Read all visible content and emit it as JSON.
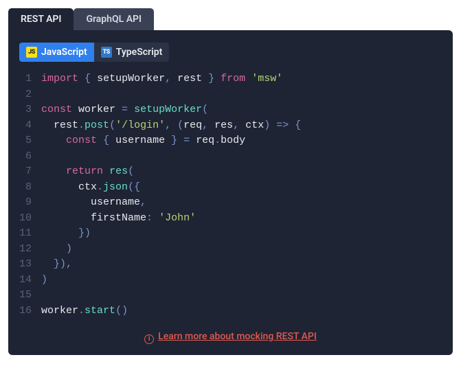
{
  "apiTabs": {
    "rest": "REST API",
    "graphql": "GraphQL API"
  },
  "langTabs": {
    "js": {
      "badge": "JS",
      "label": "JavaScript"
    },
    "ts": {
      "badge": "TS",
      "label": "TypeScript"
    }
  },
  "code": {
    "totalLines": 16,
    "lines": {
      "l1": [
        {
          "c": "tk-kw",
          "t": "import"
        },
        {
          "c": "tk-id",
          "t": " "
        },
        {
          "c": "tk-pn",
          "t": "{"
        },
        {
          "c": "tk-id",
          "t": " setupWorker"
        },
        {
          "c": "tk-pn",
          "t": ","
        },
        {
          "c": "tk-id",
          "t": " rest "
        },
        {
          "c": "tk-pn",
          "t": "}"
        },
        {
          "c": "tk-id",
          "t": " "
        },
        {
          "c": "tk-kw",
          "t": "from"
        },
        {
          "c": "tk-id",
          "t": " "
        },
        {
          "c": "tk-str",
          "t": "'msw'"
        }
      ],
      "l2": [],
      "l3": [
        {
          "c": "tk-kw",
          "t": "const"
        },
        {
          "c": "tk-id",
          "t": " worker "
        },
        {
          "c": "tk-op",
          "t": "="
        },
        {
          "c": "tk-id",
          "t": " "
        },
        {
          "c": "tk-fn",
          "t": "setupWorker"
        },
        {
          "c": "tk-pn",
          "t": "("
        }
      ],
      "l4": [
        {
          "c": "tk-id",
          "t": "  rest"
        },
        {
          "c": "tk-pn",
          "t": "."
        },
        {
          "c": "tk-fn",
          "t": "post"
        },
        {
          "c": "tk-pn",
          "t": "("
        },
        {
          "c": "tk-str",
          "t": "'/login'"
        },
        {
          "c": "tk-pn",
          "t": ","
        },
        {
          "c": "tk-id",
          "t": " "
        },
        {
          "c": "tk-pn",
          "t": "("
        },
        {
          "c": "tk-id",
          "t": "req"
        },
        {
          "c": "tk-pn",
          "t": ","
        },
        {
          "c": "tk-id",
          "t": " res"
        },
        {
          "c": "tk-pn",
          "t": ","
        },
        {
          "c": "tk-id",
          "t": " ctx"
        },
        {
          "c": "tk-pn",
          "t": ")"
        },
        {
          "c": "tk-id",
          "t": " "
        },
        {
          "c": "tk-op",
          "t": "=>"
        },
        {
          "c": "tk-id",
          "t": " "
        },
        {
          "c": "tk-pn",
          "t": "{"
        }
      ],
      "l5": [
        {
          "c": "tk-id",
          "t": "    "
        },
        {
          "c": "tk-kw",
          "t": "const"
        },
        {
          "c": "tk-id",
          "t": " "
        },
        {
          "c": "tk-pn",
          "t": "{"
        },
        {
          "c": "tk-id",
          "t": " username "
        },
        {
          "c": "tk-pn",
          "t": "}"
        },
        {
          "c": "tk-id",
          "t": " "
        },
        {
          "c": "tk-op",
          "t": "="
        },
        {
          "c": "tk-id",
          "t": " req"
        },
        {
          "c": "tk-pn",
          "t": "."
        },
        {
          "c": "tk-id",
          "t": "body"
        }
      ],
      "l6": [],
      "l7": [
        {
          "c": "tk-id",
          "t": "    "
        },
        {
          "c": "tk-kw",
          "t": "return"
        },
        {
          "c": "tk-id",
          "t": " "
        },
        {
          "c": "tk-fn",
          "t": "res"
        },
        {
          "c": "tk-pn",
          "t": "("
        }
      ],
      "l8": [
        {
          "c": "tk-id",
          "t": "      ctx"
        },
        {
          "c": "tk-pn",
          "t": "."
        },
        {
          "c": "tk-fn",
          "t": "json"
        },
        {
          "c": "tk-pn",
          "t": "({"
        }
      ],
      "l9": [
        {
          "c": "tk-id",
          "t": "        username"
        },
        {
          "c": "tk-pn",
          "t": ","
        }
      ],
      "l10": [
        {
          "c": "tk-id",
          "t": "        firstName"
        },
        {
          "c": "tk-pn",
          "t": ":"
        },
        {
          "c": "tk-id",
          "t": " "
        },
        {
          "c": "tk-str",
          "t": "'John'"
        }
      ],
      "l11": [
        {
          "c": "tk-id",
          "t": "      "
        },
        {
          "c": "tk-pn",
          "t": "})"
        }
      ],
      "l12": [
        {
          "c": "tk-id",
          "t": "    "
        },
        {
          "c": "tk-pn",
          "t": ")"
        }
      ],
      "l13": [
        {
          "c": "tk-id",
          "t": "  "
        },
        {
          "c": "tk-pn",
          "t": "}),"
        }
      ],
      "l14": [
        {
          "c": "tk-pn",
          "t": ")"
        }
      ],
      "l15": [],
      "l16": [
        {
          "c": "tk-id",
          "t": "worker"
        },
        {
          "c": "tk-pn",
          "t": "."
        },
        {
          "c": "tk-fn",
          "t": "start"
        },
        {
          "c": "tk-pn",
          "t": "()"
        }
      ]
    }
  },
  "learnMore": {
    "label": "Learn more about mocking REST API",
    "infoGlyph": "i"
  }
}
